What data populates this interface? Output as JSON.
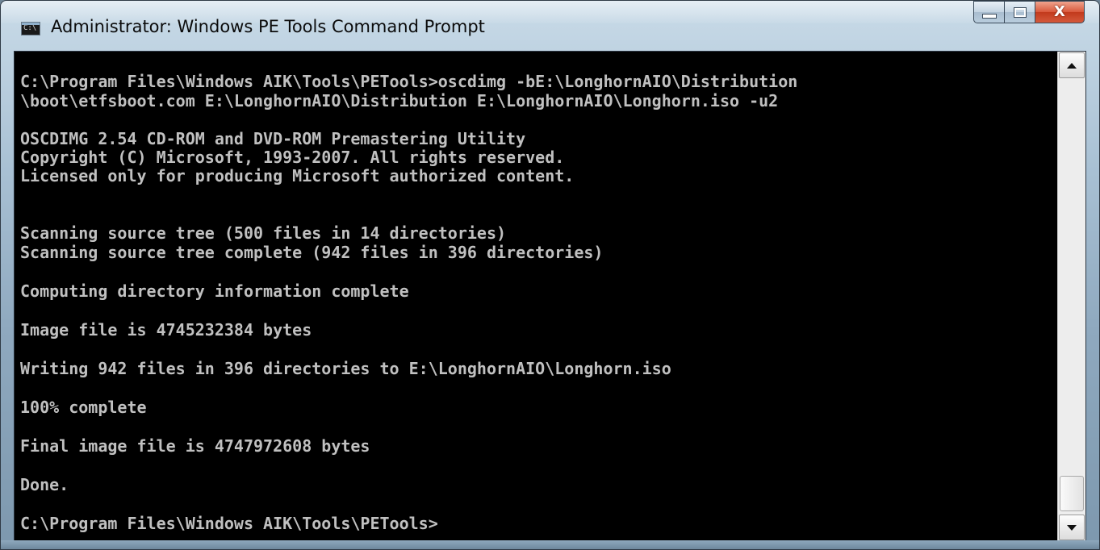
{
  "window": {
    "title": "Administrator: Windows PE Tools Command Prompt",
    "icon": "cmd-icon",
    "icon_text": "C:\\",
    "buttons": {
      "minimize": "minimize-icon",
      "maximize": "maximize-icon",
      "close_glyph": "X"
    }
  },
  "console": {
    "lines": [
      "C:\\Program Files\\Windows AIK\\Tools\\PETools>oscdimg -bE:\\LonghornAIO\\Distribution",
      "\\boot\\etfsboot.com E:\\LonghornAIO\\Distribution E:\\LonghornAIO\\Longhorn.iso -u2",
      "",
      "OSCDIMG 2.54 CD-ROM and DVD-ROM Premastering Utility",
      "Copyright (C) Microsoft, 1993-2007. All rights reserved.",
      "Licensed only for producing Microsoft authorized content.",
      "",
      "",
      "Scanning source tree (500 files in 14 directories)",
      "Scanning source tree complete (942 files in 396 directories)",
      "",
      "Computing directory information complete",
      "",
      "Image file is 4745232384 bytes",
      "",
      "Writing 942 files in 396 directories to E:\\LonghornAIO\\Longhorn.iso",
      "",
      "100% complete",
      "",
      "Final image file is 4747972608 bytes",
      "",
      "Done.",
      "",
      "C:\\Program Files\\Windows AIK\\Tools\\PETools>"
    ]
  },
  "colors": {
    "console_background": "#000000",
    "console_text": "#c0c0c0",
    "close_button": "#c8432a"
  },
  "scrollbar": {
    "up_icon": "scroll-up-arrow-icon",
    "down_icon": "scroll-down-arrow-icon",
    "position": 1.0
  }
}
